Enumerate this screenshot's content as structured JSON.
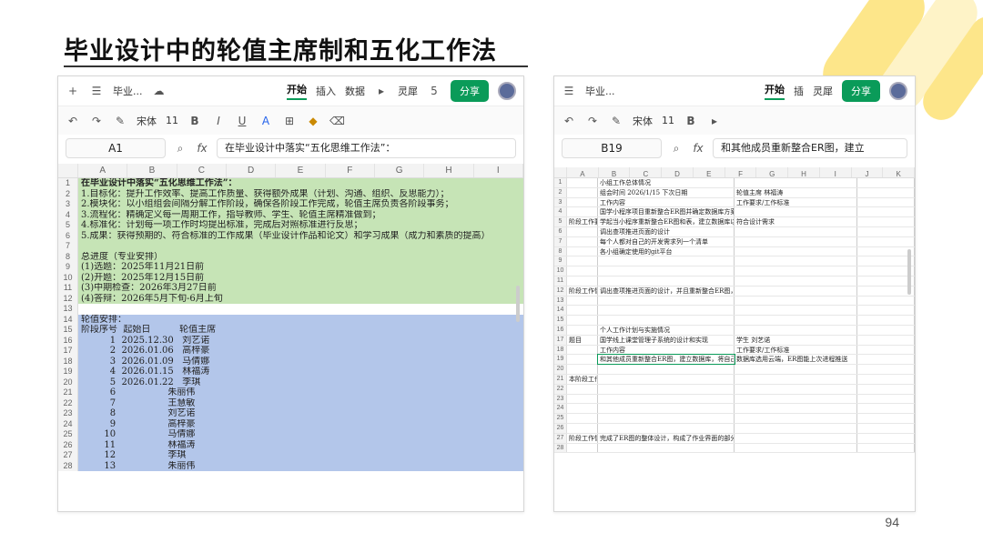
{
  "slide": {
    "title": "毕业设计中的轮值主席制和五化工作法",
    "page_number": "94"
  },
  "left": {
    "toolbar": {
      "doc_name": "毕业...",
      "tabs": [
        "开始",
        "插入",
        "数据"
      ],
      "active_tab": "开始",
      "lingxi": "灵犀",
      "share": "分享",
      "badge": "5"
    },
    "format": {
      "font": "宋体",
      "size": "11"
    },
    "formula_bar": {
      "cell": "A1",
      "formula": "在毕业设计中落实“五化思维工作法”："
    },
    "columns": [
      "A",
      "B",
      "C",
      "D",
      "E",
      "F",
      "G",
      "H",
      "I"
    ],
    "rows": [
      {
        "n": "1",
        "text": "在毕业设计中落实“五化思维工作法”：",
        "bg": "green",
        "bold": true
      },
      {
        "n": "2",
        "text": "1.目标化：提升工作效率、提高工作质量、获得额外成果（计划、沟通、组织、反思能力）；",
        "bg": "green"
      },
      {
        "n": "3",
        "text": "2.模块化：以小组组会间隔分解工作阶段，确保各阶段工作完成，轮值主席负责各阶段事务；",
        "bg": "green"
      },
      {
        "n": "4",
        "text": "3.流程化：精确定义每一周期工作，指导教师、学生、轮值主席精准做到；",
        "bg": "green"
      },
      {
        "n": "5",
        "text": "4.标准化：计划每一项工作时均提出标准，完成后对照标准进行反思；",
        "bg": "green"
      },
      {
        "n": "6",
        "text": "5.成果：获得预期的、符合标准的工作成果（毕业设计作品和论文）和学习成果（成力和素质的提高）",
        "bg": "green"
      },
      {
        "n": "7",
        "text": "",
        "bg": "green"
      },
      {
        "n": "8",
        "text": "总进度（专业安排）",
        "bg": "green"
      },
      {
        "n": "9",
        "text": "(1)选题：2025年11月21日前",
        "bg": "green"
      },
      {
        "n": "10",
        "text": "(2)开题：2025年12月15日前",
        "bg": "green"
      },
      {
        "n": "11",
        "text": "(3)中期检查：2026年3月27日前",
        "bg": "green"
      },
      {
        "n": "12",
        "text": "(4)答辩：2026年5月下旬-6月上旬",
        "bg": "green"
      },
      {
        "n": "13",
        "text": "",
        "bg": "none"
      },
      {
        "n": "14",
        "text": "轮值安排：",
        "bg": "blue"
      },
      {
        "n": "15",
        "text": "阶段序号  起始日          轮值主席",
        "bg": "blue"
      },
      {
        "n": "16",
        "text": "          1  2025.12.30   刘艺诺",
        "bg": "blue"
      },
      {
        "n": "17",
        "text": "          2  2026.01.06   高梓豪",
        "bg": "blue"
      },
      {
        "n": "18",
        "text": "          3  2026.01.09   马倩娜",
        "bg": "blue"
      },
      {
        "n": "19",
        "text": "          4  2026.01.15   林福涛",
        "bg": "blue"
      },
      {
        "n": "20",
        "text": "          5  2026.01.22   李琪",
        "bg": "blue"
      },
      {
        "n": "21",
        "text": "          6                  朱丽伟",
        "bg": "blue"
      },
      {
        "n": "22",
        "text": "          7                  王慧敏",
        "bg": "blue"
      },
      {
        "n": "23",
        "text": "          8                  刘艺诺",
        "bg": "blue"
      },
      {
        "n": "24",
        "text": "          9                  高梓豪",
        "bg": "blue"
      },
      {
        "n": "25",
        "text": "        10                  马倩娜",
        "bg": "blue"
      },
      {
        "n": "26",
        "text": "        11                  林福涛",
        "bg": "blue"
      },
      {
        "n": "27",
        "text": "        12                  李琪",
        "bg": "blue"
      },
      {
        "n": "28",
        "text": "        13                  朱丽伟",
        "bg": "blue"
      }
    ]
  },
  "right": {
    "toolbar": {
      "doc_name": "毕业...",
      "tabs": [
        "开始",
        "插"
      ],
      "active_tab": "开始",
      "lingxi": "灵犀",
      "share": "分享"
    },
    "format": {
      "font": "宋体",
      "size": "11"
    },
    "formula_bar": {
      "cell": "B19",
      "formula": "和其他成员重新整合ER图，建立"
    },
    "columns": [
      "A",
      "B",
      "C",
      "D",
      "E",
      "F",
      "G",
      "H",
      "I",
      "J",
      "K"
    ],
    "rows": [
      {
        "n": "1",
        "a": "",
        "b": "小组工作总体情况",
        "c": ""
      },
      {
        "n": "2",
        "a": "",
        "b": "组会时间          2026/1/15    下次日期",
        "c": "轮值主席  林福涛"
      },
      {
        "n": "3",
        "a": "",
        "b": "工作内容",
        "c": "工作要求/工作标准"
      },
      {
        "n": "4",
        "a": "",
        "b": "国学小程序项目重新整合ER图并确定数据库方案。代码推送并上传git",
        "c": ""
      },
      {
        "n": "5",
        "a": "阶段工作要点",
        "b": "学起当小程序重新整合ER图和表，建立数据库以及推送代码上传git",
        "c": "符合设计需求"
      },
      {
        "n": "6",
        "a": "",
        "b": "调出查项推进页面的设计",
        "c": ""
      },
      {
        "n": "7",
        "a": "",
        "b": "每个人都对自己的开发需求列一个清单",
        "c": ""
      },
      {
        "n": "8",
        "a": "",
        "b": "各小组确定使用的git平台",
        "c": ""
      },
      {
        "n": "9",
        "a": "",
        "b": "",
        "c": ""
      },
      {
        "n": "10",
        "a": "",
        "b": "",
        "c": ""
      },
      {
        "n": "11",
        "a": "",
        "b": "",
        "c": ""
      },
      {
        "n": "12",
        "a": "阶段工作情况小结",
        "b": "调出查项推进页面的设计，并且重新整合ER图，确定最终的数据库方案，以及采纳初步的前端页面设计。",
        "c": ""
      },
      {
        "n": "13",
        "a": "",
        "b": "",
        "c": ""
      },
      {
        "n": "14",
        "a": "",
        "b": "",
        "c": ""
      },
      {
        "n": "15",
        "a": "",
        "b": "",
        "c": ""
      },
      {
        "n": "16",
        "a": "",
        "b": "个人工作计划与实施情况",
        "c": ""
      },
      {
        "n": "17",
        "a": "题目",
        "b": "国学线上课堂管理子系统的设计和实现",
        "c": "学生  刘艺诺"
      },
      {
        "n": "18",
        "a": "",
        "b": "工作内容",
        "c": "工作要求/工作标准"
      },
      {
        "n": "19",
        "a": "",
        "b": "和其他成员重新整合ER图，建立数据库，将自己的开发需求列一个清单",
        "c": "数据库选用云端，ER图能上次进程推送"
      },
      {
        "n": "20",
        "a": "",
        "b": "",
        "c": ""
      },
      {
        "n": "21",
        "a": "本阶段工作要点",
        "b": "",
        "c": ""
      },
      {
        "n": "22",
        "a": "",
        "b": "",
        "c": ""
      },
      {
        "n": "23",
        "a": "",
        "b": "",
        "c": ""
      },
      {
        "n": "24",
        "a": "",
        "b": "",
        "c": ""
      },
      {
        "n": "25",
        "a": "",
        "b": "",
        "c": ""
      },
      {
        "n": "26",
        "a": "",
        "b": "",
        "c": ""
      },
      {
        "n": "27",
        "a": "阶段工作情况小结",
        "b": "完成了ER图的整体设计，构成了作业界面的部分",
        "c": ""
      },
      {
        "n": "28",
        "a": "",
        "b": "",
        "c": ""
      }
    ]
  },
  "colors": {
    "accent": "#0a9b59",
    "green": "#c6e4b6",
    "blue": "#b3c6ea",
    "deco": "#fde68a"
  }
}
